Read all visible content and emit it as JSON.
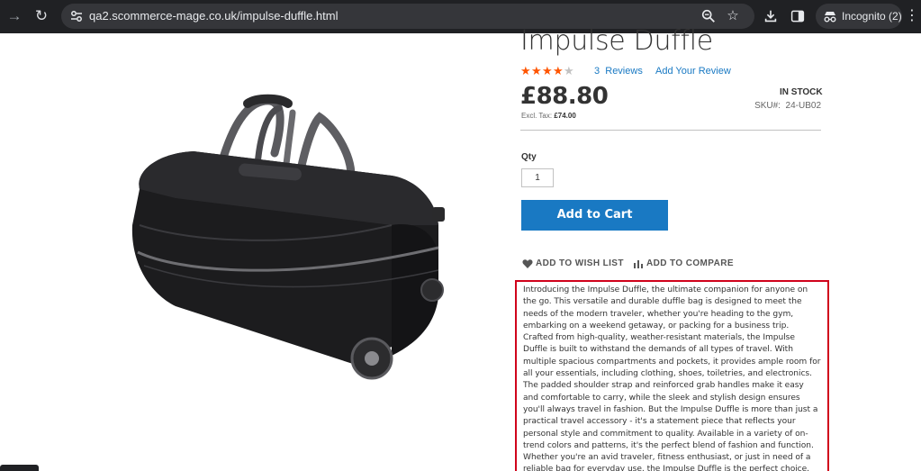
{
  "browser": {
    "url": "qa2.scommerce-mage.co.uk/impulse-duffle.html",
    "profile_label": "Incognito (2)"
  },
  "product": {
    "title": "Impulse Duffle",
    "rating_stars": 4,
    "rating_max": 5,
    "reviews_count": "3",
    "reviews_word": "Reviews",
    "add_review": "Add Your Review",
    "price": "£88.80",
    "excl_tax_label": "Excl. Tax:",
    "excl_tax_value": "£74.00",
    "stock": "IN STOCK",
    "sku_label": "SKU#:",
    "sku_value": "24-UB02",
    "qty_label": "Qty",
    "qty_value": "1",
    "add_to_cart": "Add to Cart",
    "wish_list": "ADD TO WISH LIST",
    "compare": "ADD TO COMPARE",
    "description": "Introducing the Impulse Duffle, the ultimate companion for anyone on the go. This versatile and durable duffle bag is designed to meet the needs of the modern traveler, whether you're heading to the gym, embarking on a weekend getaway, or packing for a business trip. Crafted from high-quality, weather-resistant materials, the Impulse Duffle is built to withstand the demands of all types of travel. With multiple spacious compartments and pockets, it provides ample room for all your essentials, including clothing, shoes, toiletries, and electronics. The padded shoulder strap and reinforced grab handles make it easy and comfortable to carry, while the sleek and stylish design ensures you'll always travel in fashion. But the Impulse Duffle is more than just a practical travel accessory - it's a statement piece that reflects your personal style and commitment to quality. Available in a variety of on-trend colors and patterns, it's the perfect blend of fashion and function. Whether you're an avid traveler, fitness enthusiast, or just in need of a reliable bag for everyday use, the Impulse Duffle is the perfect choice. Elevate your travel experience and make a statement with the Impulse"
  },
  "colors": {
    "accent": "#1979c3",
    "rating_star": "#ff5501",
    "highlight_border": "#d0021b",
    "chrome_bg": "#202124"
  },
  "icons": [
    "forward-icon",
    "reload-icon",
    "site-info-icon",
    "zoom-icon",
    "bookmark-star-icon",
    "download-icon",
    "side-panel-icon",
    "incognito-icon",
    "menu-icon",
    "heart-icon",
    "bar-chart-icon"
  ]
}
